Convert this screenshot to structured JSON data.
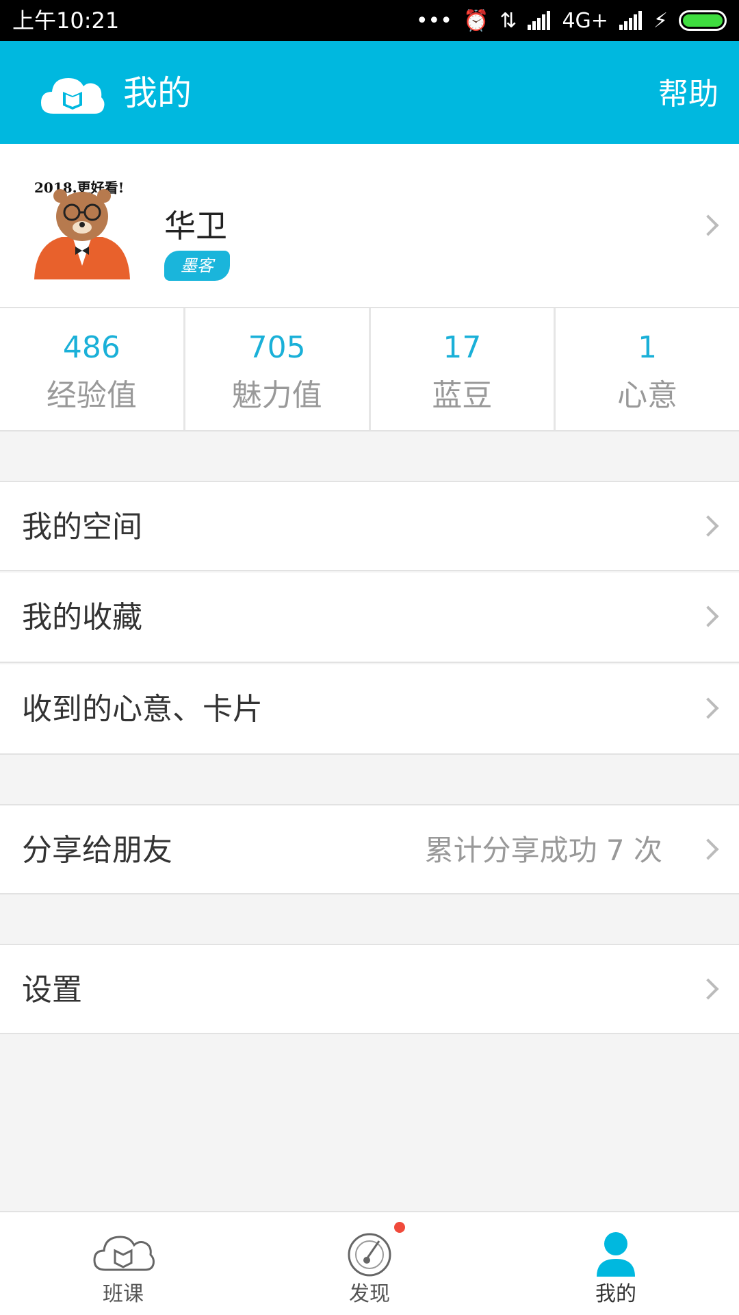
{
  "status_bar": {
    "time": "上午10:21",
    "network": "4G+"
  },
  "app_bar": {
    "title": "我的",
    "help_label": "帮助"
  },
  "profile": {
    "avatar_text": "2018.更好看!",
    "name": "华卫",
    "badge_text": "墨客"
  },
  "stats": [
    {
      "value": "486",
      "label": "经验值"
    },
    {
      "value": "705",
      "label": "魅力值"
    },
    {
      "value": "17",
      "label": "蓝豆"
    },
    {
      "value": "1",
      "label": "心意"
    }
  ],
  "menu": {
    "my_space": "我的空间",
    "my_favorites": "我的收藏",
    "received_gifts": "收到的心意、卡片",
    "share": {
      "label": "分享给朋友",
      "count_text": "累计分享成功 7 次"
    },
    "settings": "设置"
  },
  "tabs": [
    {
      "label": "班课",
      "icon": "cloud-book-icon"
    },
    {
      "label": "发现",
      "icon": "compass-icon"
    },
    {
      "label": "我的",
      "icon": "person-icon"
    }
  ],
  "colors": {
    "accent": "#00b8df",
    "stat_value": "#1ab0d8",
    "notification": "#f04a3b"
  }
}
